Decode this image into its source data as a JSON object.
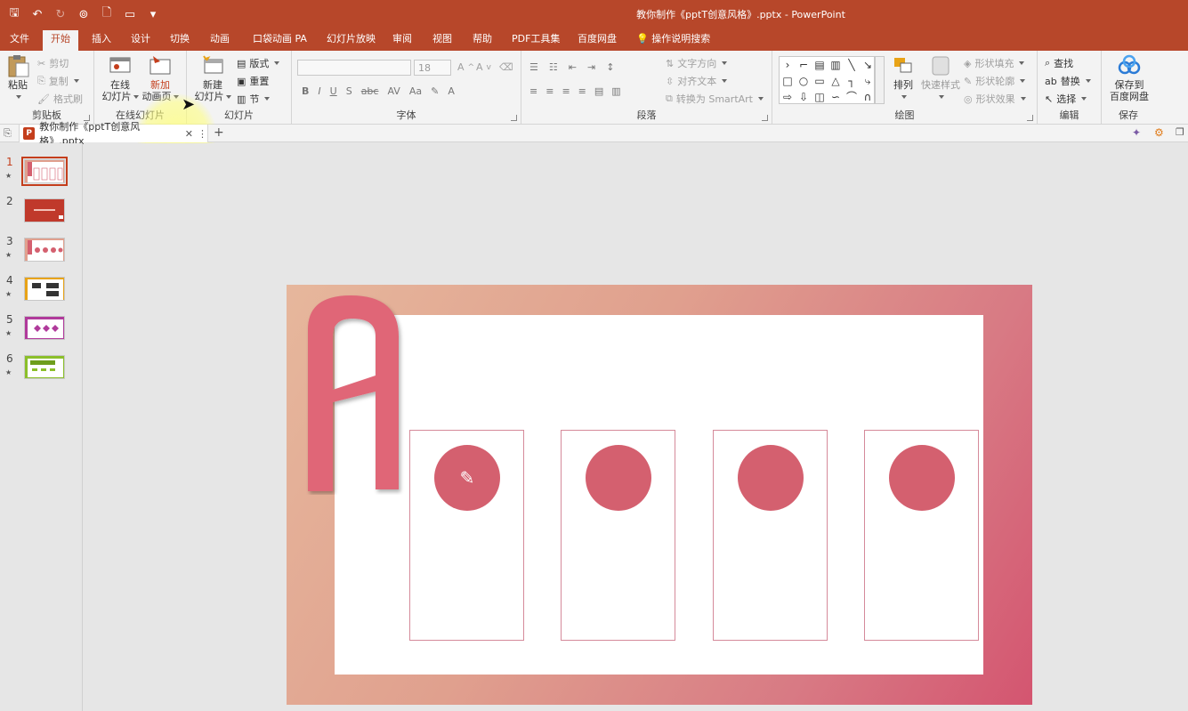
{
  "app": {
    "title": "教你制作《pptT创意风格》.pptx  -  PowerPoint"
  },
  "tabs": [
    {
      "label": "文件"
    },
    {
      "label": "开始",
      "active": true
    },
    {
      "label": "插入"
    },
    {
      "label": "设计"
    },
    {
      "label": "切换"
    },
    {
      "label": "动画"
    },
    {
      "label": "口袋动画 PA"
    },
    {
      "label": "幻灯片放映"
    },
    {
      "label": "审阅"
    },
    {
      "label": "视图"
    },
    {
      "label": "帮助"
    },
    {
      "label": "PDF工具集"
    },
    {
      "label": "百度网盘"
    }
  ],
  "tellme": "操作说明搜索",
  "ribbon": {
    "clipboard": {
      "paste": "粘贴",
      "cut": "剪切",
      "copy": "复制",
      "format_painter": "格式刷",
      "label": "剪贴板"
    },
    "online_slides": {
      "online_line1": "在线",
      "online_line2": "幻灯片",
      "new_anim_line1": "新加",
      "new_anim_line2": "动画页",
      "label": "在线幻灯片"
    },
    "slides": {
      "new_line1": "新建",
      "new_line2": "幻灯片",
      "layout": "版式",
      "reset": "重置",
      "section": "节",
      "label": "幻灯片"
    },
    "font": {
      "size": "18",
      "label": "字体",
      "bold": "B",
      "italic": "I",
      "underline": "U",
      "strike": "S",
      "abc": "abc",
      "spacing": "AV",
      "case": "Aa",
      "color": "A"
    },
    "paragraph": {
      "text_direction": "文字方向",
      "align_text": "对齐文本",
      "smartart": "转换为 SmartArt",
      "label": "段落"
    },
    "drawing": {
      "arrange": "排列",
      "quick_styles": "快速样式",
      "shape_fill": "形状填充",
      "shape_outline": "形状轮廓",
      "shape_effects": "形状效果",
      "label": "绘图"
    },
    "editing": {
      "find": "查找",
      "replace": "替换",
      "select": "选择",
      "label": "编辑"
    },
    "save": {
      "line1": "保存到",
      "line2": "百度网盘",
      "label": "保存"
    }
  },
  "doc_tab": {
    "name": "教你制作《pptT创意风格》.pptx"
  },
  "thumbnails": [
    {
      "num": "1",
      "star": "★"
    },
    {
      "num": "2",
      "star": ""
    },
    {
      "num": "3",
      "star": "★"
    },
    {
      "num": "4",
      "star": "★"
    },
    {
      "num": "5",
      "star": "★"
    },
    {
      "num": "6",
      "star": "★"
    }
  ],
  "colors": {
    "accent": "#b7472a",
    "slide_pink": "#d4606f"
  }
}
